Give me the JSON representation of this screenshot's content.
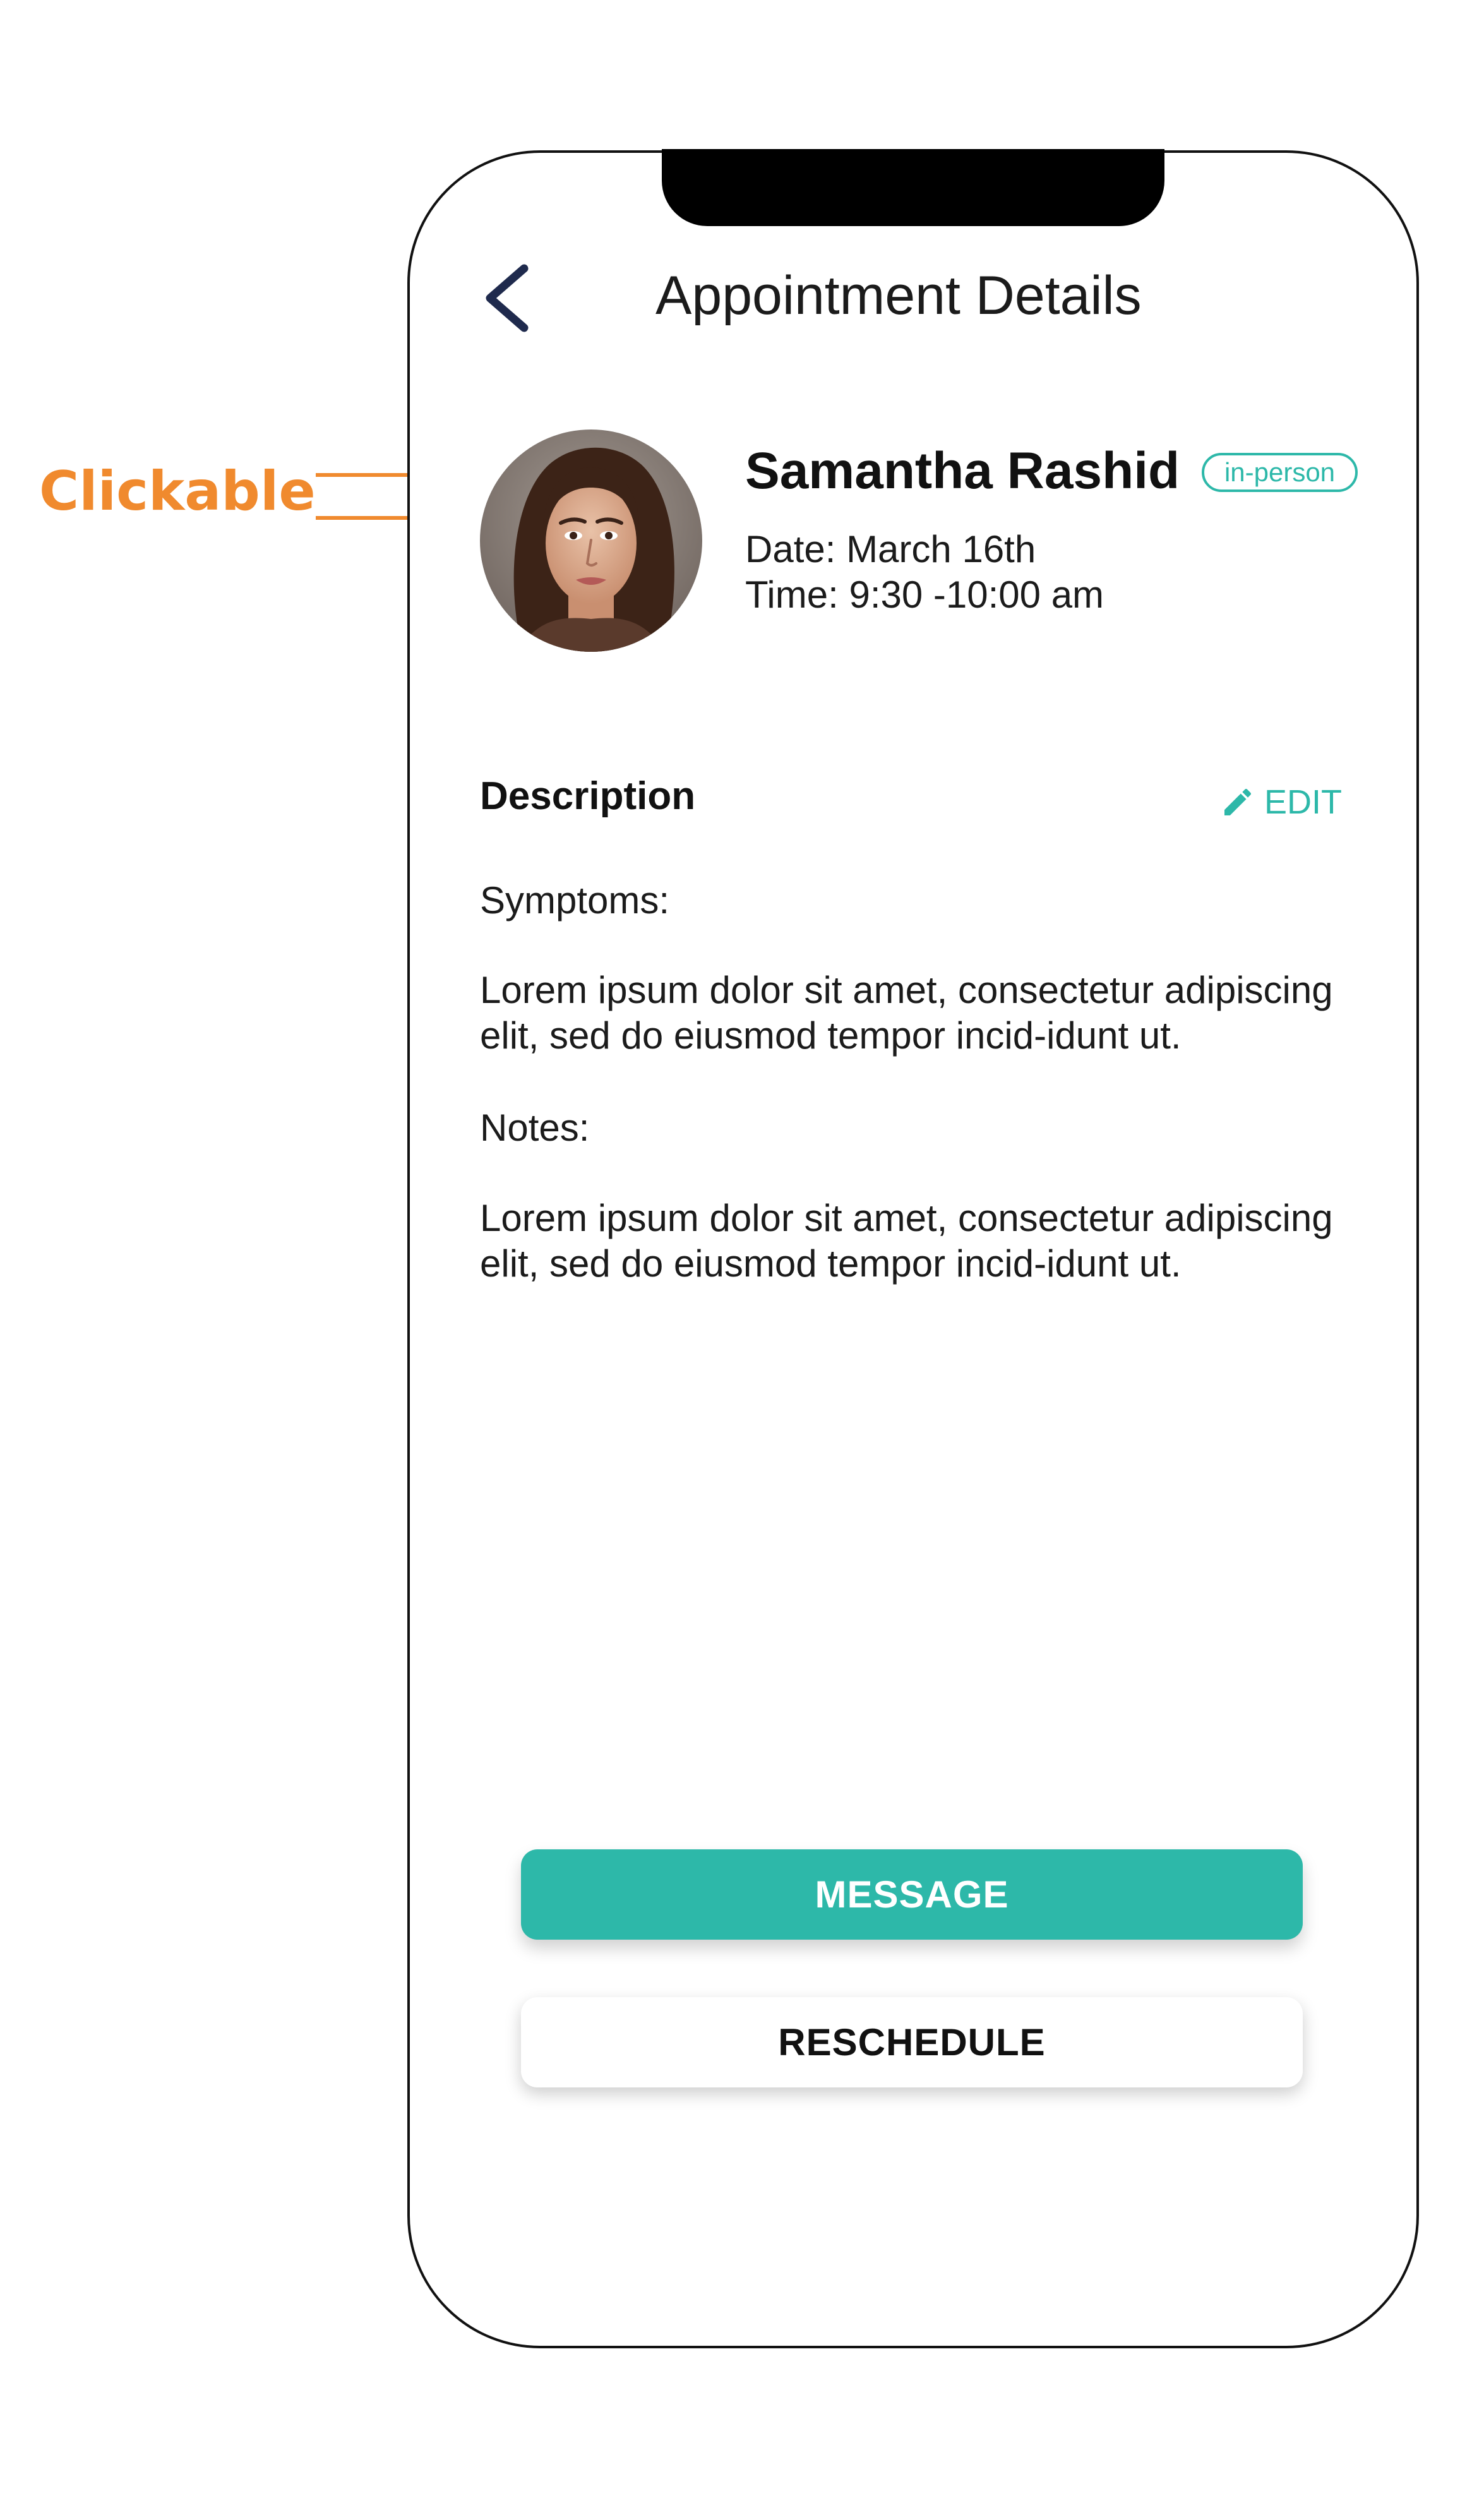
{
  "annotation": {
    "label": "Clickable",
    "color": "#f08a2e"
  },
  "header": {
    "back_icon": "chevron-left-icon",
    "title": "Appointment Details"
  },
  "patient": {
    "name": "Samantha Rashid",
    "visit_type": "in-person",
    "date": "Date: March 16th",
    "time": "Time: 9:30 -10:00 am"
  },
  "description": {
    "heading": "Description",
    "edit_icon": "pencil-icon",
    "edit_label": "EDIT",
    "symptoms_label": "Symptoms:",
    "symptoms_text": "Lorem ipsum dolor sit amet, consectetur adipiscing elit, sed do eiusmod tempor incid-idunt ut.",
    "notes_label": "Notes:",
    "notes_text": "Lorem ipsum dolor sit amet, consectetur adipiscing elit, sed do eiusmod tempor incid-idunt ut."
  },
  "actions": {
    "message_label": "MESSAGE",
    "reschedule_label": "RESCHEDULE"
  },
  "colors": {
    "accent": "#2db8a9",
    "header_icon": "#1f2a4d",
    "annotation": "#f08a2e"
  }
}
